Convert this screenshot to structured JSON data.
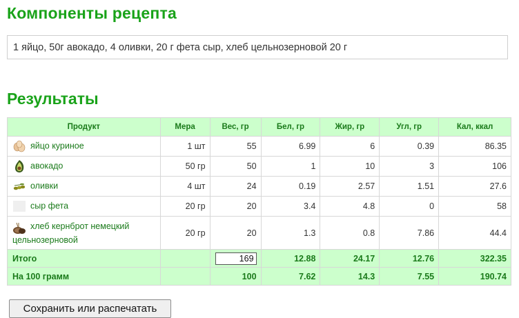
{
  "recipe": {
    "heading": "Компоненты рецепта",
    "text": "1 яйцо, 50г авокадо, 4 оливки, 20 г фета сыр, хлеб цельнозерновой 20 г"
  },
  "results": {
    "heading": "Результаты",
    "headers": [
      "Продукт",
      "Мера",
      "Вес, гр",
      "Бел, гр",
      "Жир, гр",
      "Угл, гр",
      "Кал, ккал"
    ],
    "rows": [
      {
        "icon": "egg-icon",
        "name": "яйцо куриное",
        "measure": "1 шт",
        "weight": "55",
        "protein": "6.99",
        "fat": "6",
        "carbs": "0.39",
        "kcal": "86.35"
      },
      {
        "icon": "avocado-icon",
        "name": "авокадо",
        "measure": "50 гр",
        "weight": "50",
        "protein": "1",
        "fat": "10",
        "carbs": "3",
        "kcal": "106"
      },
      {
        "icon": "olives-icon",
        "name": "оливки",
        "measure": "4 шт",
        "weight": "24",
        "protein": "0.19",
        "fat": "2.57",
        "carbs": "1.51",
        "kcal": "27.6"
      },
      {
        "icon": "feta-icon",
        "name": "сыр фета",
        "measure": "20 гр",
        "weight": "20",
        "protein": "3.4",
        "fat": "4.8",
        "carbs": "0",
        "kcal": "58"
      },
      {
        "icon": "bread-icon",
        "name": "хлеб кернброт немецкий цельнозерновой",
        "measure": "20 гр",
        "weight": "20",
        "protein": "1.3",
        "fat": "0.8",
        "carbs": "7.86",
        "kcal": "44.4"
      }
    ],
    "total": {
      "label": "Итого",
      "weight": "169",
      "protein": "12.88",
      "fat": "24.17",
      "carbs": "12.76",
      "kcal": "322.35"
    },
    "per100": {
      "label": "На 100 грамм",
      "weight": "100",
      "protein": "7.62",
      "fat": "14.3",
      "carbs": "7.55",
      "kcal": "190.74"
    }
  },
  "actions": {
    "save_label": "Сохранить или распечатать"
  }
}
